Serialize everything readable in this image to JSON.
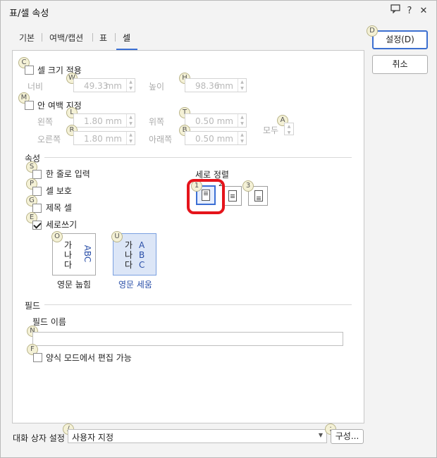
{
  "window": {
    "title": "표/셀 속성",
    "help_label": "?",
    "close_label": "✕"
  },
  "tabs": [
    {
      "label": "기본"
    },
    {
      "label": "여백/캡션"
    },
    {
      "label": "표"
    },
    {
      "label": "셀"
    }
  ],
  "buttons": {
    "ok": "설정(D)",
    "cancel": "취소",
    "config": "구성..."
  },
  "cell_size": {
    "checkbox_label": "셀 크기 적용",
    "width_label": "너비",
    "width_value": "49.33",
    "height_label": "높이",
    "height_value": "98.36",
    "unit": "mm"
  },
  "inner_margin": {
    "checkbox_label": "안 여백 지정",
    "left_label": "왼쪽",
    "left_value": "1.80",
    "top_label": "위쪽",
    "top_value": "0.50",
    "right_label": "오른쪽",
    "right_value": "1.80",
    "bottom_label": "아래쪽",
    "bottom_value": "0.50",
    "all_label": "모두",
    "unit": "mm"
  },
  "attributes": {
    "section_title": "속성",
    "single_line_label": "한 줄로 입력",
    "cell_protect_label": "셀 보호",
    "title_cell_label": "제목 셀",
    "vertical_writing_label": "세로쓰기",
    "vertical_writing_checked": true,
    "vertical_align_label": "세로 정렬",
    "vertical_align_selected": 1
  },
  "latin": {
    "lying_label": "영문 눕힘",
    "upright_label": "영문 세움",
    "lying_korean": [
      "가",
      "나",
      "다"
    ],
    "lying_latin": "ABC",
    "upright_korean": [
      "가",
      "나",
      "다"
    ],
    "upright_latin": [
      "A",
      "B",
      "C"
    ]
  },
  "field": {
    "section_title": "필드",
    "name_label": "필드 이름",
    "name_value": "",
    "editable_label": "양식 모드에서 편집 가능"
  },
  "dialog_setting": {
    "label": "대화 상자 설정",
    "value": "사용자 지정"
  },
  "badges": {
    "C": "C",
    "W": "W",
    "H": "H",
    "M": "M",
    "L": "L",
    "T": "T",
    "R": "R",
    "B": "B",
    "A": "A",
    "S": "S",
    "P": "P",
    "G": "G",
    "E": "E",
    "O": "O",
    "U": "U",
    "N": "N",
    "F": "F",
    "D": "D",
    "one": "1",
    "two": "2",
    "three": "3",
    "slash": "/",
    "semi": ";"
  },
  "colors": {
    "accent": "#3b6fd4",
    "highlight": "#e5141b",
    "selected_bg": "#dce6f7"
  }
}
